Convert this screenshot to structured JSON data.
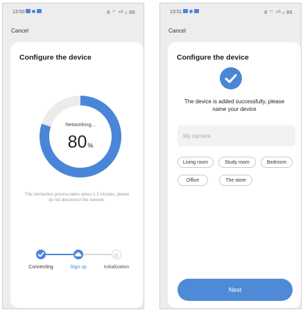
{
  "left_screen": {
    "status": {
      "time": "13:50",
      "system_icons": "8 ⌔ ⁴ᴳ ᵢₗ 80"
    },
    "cancel_label": "Cancel",
    "title": "Configure the device",
    "progress": {
      "label": "Networking...",
      "value": "80",
      "unit": "%",
      "fraction": 0.8
    },
    "hint": "The connection process takes about 1-2 minutes, please do not disconnect the network.",
    "steps": [
      {
        "label": "Connecting",
        "state": "done"
      },
      {
        "label": "Sign up",
        "state": "active"
      },
      {
        "label": "Initialization",
        "state": "pending"
      }
    ]
  },
  "right_screen": {
    "status": {
      "time": "13:51",
      "system_icons": "8 ⌔ ⁴ᴳ ᵢₗ 80"
    },
    "cancel_label": "Cancel",
    "title": "Configure the device",
    "message": "The device is added successfully, please name your device",
    "name_input": {
      "placeholder": "My camera",
      "value": ""
    },
    "room_chips": [
      "Living room",
      "Study room",
      "Bedroom",
      "Office",
      "The store"
    ],
    "next_label": "Next"
  },
  "colors": {
    "accent": "#4a86d8",
    "ring_track": "#ebebeb",
    "step_pending": "#d7d7d7",
    "background": "#ededed"
  }
}
